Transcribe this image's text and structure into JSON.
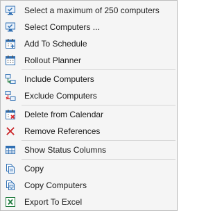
{
  "menu": {
    "items": [
      {
        "label": "Select a maximum of 250 computers",
        "icon": "monitor-check-icon"
      },
      {
        "label": "Select Computers ...",
        "icon": "monitor-check-icon"
      },
      {
        "label": "Add To Schedule",
        "icon": "calendar-add-icon"
      },
      {
        "label": "Rollout Planner",
        "icon": "calendar-grid-icon"
      },
      {
        "label": "Include Computers",
        "icon": "network-include-icon"
      },
      {
        "label": "Exclude Computers",
        "icon": "network-exclude-icon"
      },
      {
        "label": "Delete from Calendar",
        "icon": "calendar-delete-icon"
      },
      {
        "label": "Remove References",
        "icon": "red-x-icon"
      },
      {
        "label": "Show Status Columns",
        "icon": "table-columns-icon"
      },
      {
        "label": "Copy",
        "icon": "copy-icon"
      },
      {
        "label": "Copy Computers",
        "icon": "copy-computers-icon"
      },
      {
        "label": "Export To Excel",
        "icon": "excel-icon"
      }
    ]
  },
  "colors": {
    "menu_background": "#f5f5f5",
    "icon_blue": "#2f6fb3",
    "icon_red": "#d9262b",
    "icon_green": "#1e7a3c"
  }
}
